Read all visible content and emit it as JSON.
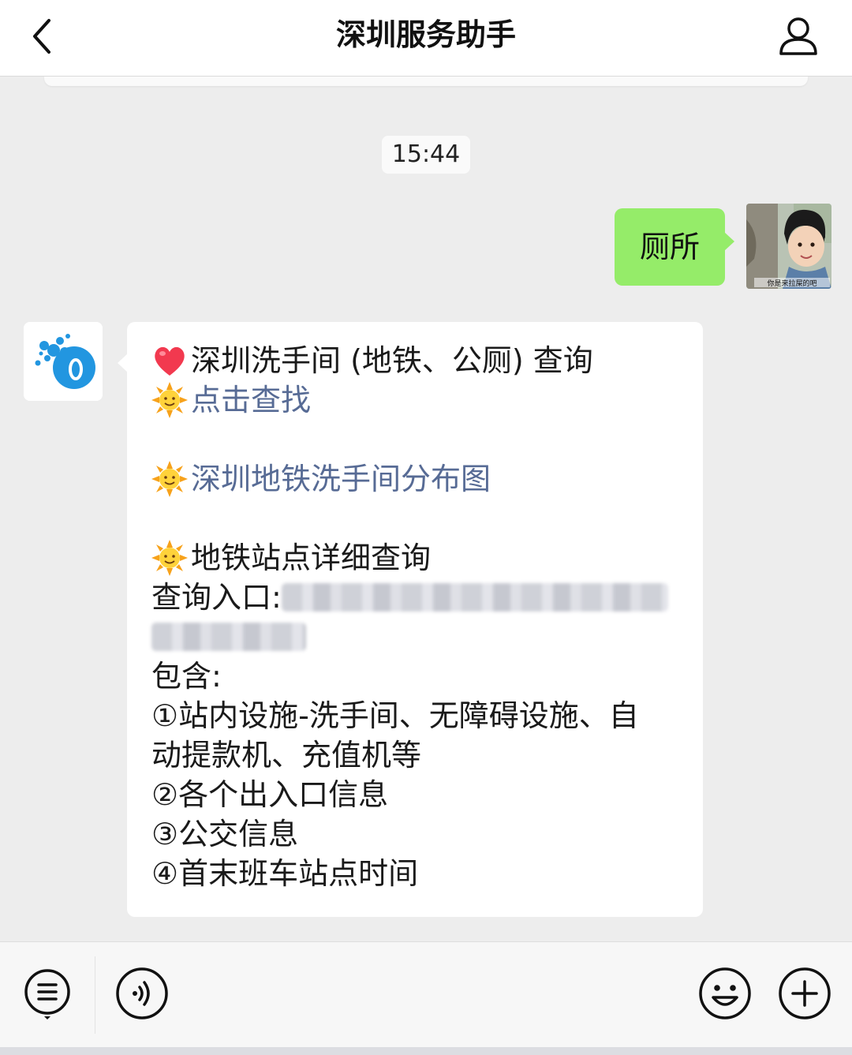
{
  "header": {
    "title": "深圳服务助手",
    "back_icon": "chevron-left-icon",
    "profile_icon": "person-icon"
  },
  "chat": {
    "timestamp": "15:44",
    "user_message": {
      "text": "厕所",
      "bubble_color": "#95ec69"
    },
    "user_avatar": {
      "caption": "你是来拉屎的吧"
    },
    "bot_message": {
      "heading_icon": "heart-icon",
      "heading": "深圳洗手间 (地铁、公厕) 查询",
      "bullet_icon": "sun-icon",
      "link1": "点击查找",
      "link2": "深圳地铁洗手间分布图",
      "section_title": "地铁站点详细查询",
      "entry_label": "查询入口:",
      "includes_label": "包含:",
      "items": [
        "①站内设施-洗手间、无障碍设施、自",
        "动提款机、充值机等",
        "②各个出入口信息",
        "③公交信息",
        "④首末班车站点时间"
      ],
      "link_color": "#576b95"
    }
  },
  "toolbar": {
    "menu_icon": "menu-icon",
    "voice_icon": "voice-icon",
    "emoji_icon": "emoji-icon",
    "plus_icon": "plus-icon"
  },
  "colors": {
    "background": "#ededed",
    "header": "#ffffff"
  }
}
